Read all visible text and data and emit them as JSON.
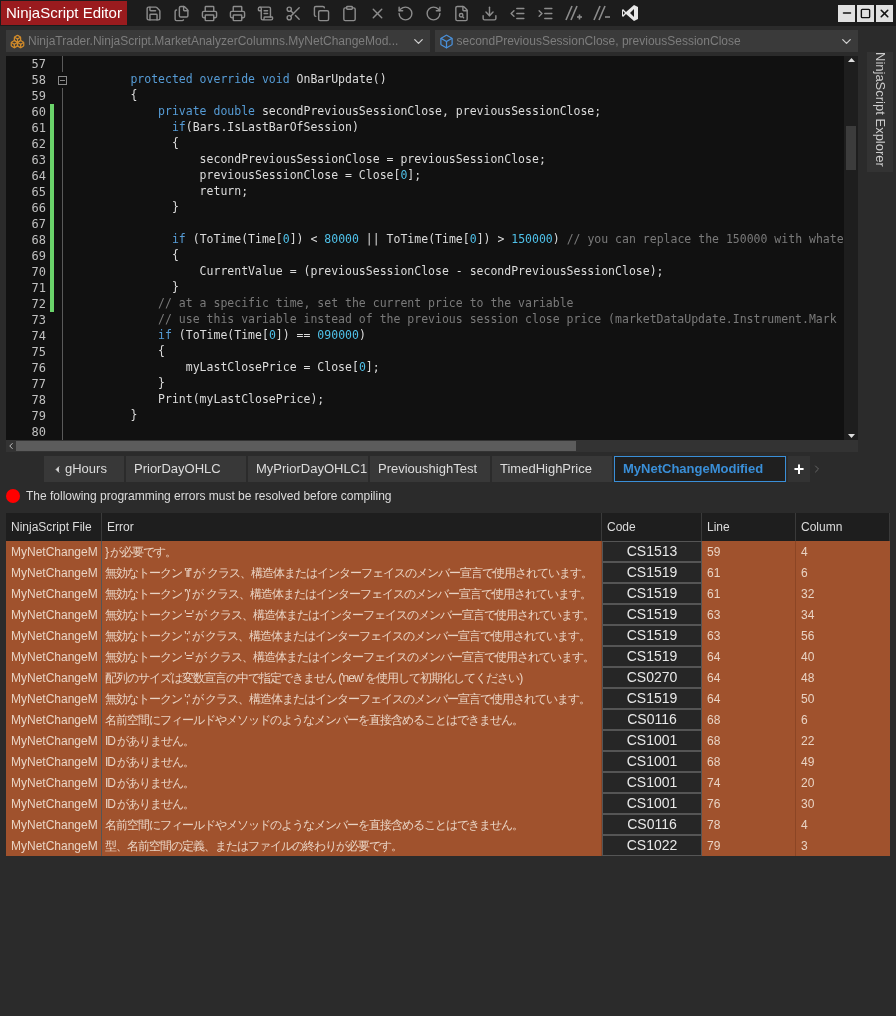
{
  "window": {
    "title": "NinjaScript Editor"
  },
  "dropdowns": [
    {
      "text": "NinjaTrader.NinjaScript.MarketAnalyzerColumns.MyNetChangeMod..."
    },
    {
      "text": "secondPreviousSessionClose, previousSessionClose"
    }
  ],
  "side_panel": {
    "label": "NinjaScript Explorer"
  },
  "editor": {
    "lines": [
      {
        "number": "57",
        "changed": false,
        "collapsible": false
      },
      {
        "number": "58",
        "changed": false,
        "collapsible": true,
        "tokens": [
          {
            "kind": "keyword",
            "text": "        protected override void"
          },
          {
            "kind": "plain",
            "text": " OnBarUpdate()"
          }
        ]
      },
      {
        "number": "59",
        "changed": false,
        "collapsible": false,
        "tokens": [
          {
            "kind": "plain",
            "text": "        {"
          }
        ]
      },
      {
        "number": "60",
        "changed": true,
        "collapsible": false,
        "tokens": [
          {
            "kind": "keyword",
            "text": "            private double"
          },
          {
            "kind": "plain",
            "text": " secondPreviousSessionClose, previousSessionClose;"
          }
        ]
      },
      {
        "number": "61",
        "changed": true,
        "collapsible": false,
        "tokens": [
          {
            "kind": "keyword",
            "text": "              if"
          },
          {
            "kind": "plain",
            "text": "(Bars.IsLastBarOfSession)"
          }
        ]
      },
      {
        "number": "62",
        "changed": true,
        "collapsible": false,
        "tokens": [
          {
            "kind": "plain",
            "text": "              {"
          }
        ]
      },
      {
        "number": "63",
        "changed": true,
        "collapsible": false,
        "tokens": [
          {
            "kind": "plain",
            "text": "                  secondPreviousSessionClose = previousSessionClose;"
          }
        ]
      },
      {
        "number": "64",
        "changed": true,
        "collapsible": false,
        "tokens": [
          {
            "kind": "plain",
            "text": "                  previousSessionClose = Close["
          },
          {
            "kind": "number",
            "text": "0"
          },
          {
            "kind": "plain",
            "text": "];"
          }
        ]
      },
      {
        "number": "65",
        "changed": true,
        "collapsible": false,
        "tokens": [
          {
            "kind": "plain",
            "text": "                  return;"
          }
        ]
      },
      {
        "number": "66",
        "changed": true,
        "collapsible": false,
        "tokens": [
          {
            "kind": "plain",
            "text": "              }"
          }
        ]
      },
      {
        "number": "67",
        "changed": true,
        "collapsible": false
      },
      {
        "number": "68",
        "changed": true,
        "collapsible": false,
        "tokens": [
          {
            "kind": "keyword",
            "text": "              if"
          },
          {
            "kind": "plain",
            "text": " (ToTime(Time["
          },
          {
            "kind": "number",
            "text": "0"
          },
          {
            "kind": "plain",
            "text": "]) < "
          },
          {
            "kind": "number",
            "text": "80000"
          },
          {
            "kind": "plain",
            "text": " || ToTime(Time["
          },
          {
            "kind": "number",
            "text": "0"
          },
          {
            "kind": "plain",
            "text": "]) > "
          },
          {
            "kind": "number",
            "text": "150000"
          },
          {
            "kind": "plain",
            "text": ")"
          },
          {
            "kind": "comment",
            "text": " // you can replace the 150000 with whate"
          }
        ]
      },
      {
        "number": "69",
        "changed": true,
        "collapsible": false,
        "tokens": [
          {
            "kind": "plain",
            "text": "              {"
          }
        ]
      },
      {
        "number": "70",
        "changed": true,
        "collapsible": false,
        "tokens": [
          {
            "kind": "plain",
            "text": "                  CurrentValue = (previousSessionClose - secondPreviousSessionClose);"
          }
        ]
      },
      {
        "number": "71",
        "changed": true,
        "collapsible": false,
        "tokens": [
          {
            "kind": "plain",
            "text": "              }"
          }
        ]
      },
      {
        "number": "72",
        "changed": true,
        "collapsible": false,
        "tokens": [
          {
            "kind": "comment",
            "text": "            // at a specific time, set the current price to the variable"
          }
        ]
      },
      {
        "number": "73",
        "changed": false,
        "collapsible": false,
        "tokens": [
          {
            "kind": "comment",
            "text": "            // use this variable instead of the previous session close price (marketDataUpdate.Instrument.Mark"
          }
        ]
      },
      {
        "number": "74",
        "changed": false,
        "collapsible": false,
        "tokens": [
          {
            "kind": "keyword",
            "text": "            if"
          },
          {
            "kind": "plain",
            "text": " (ToTime(Time["
          },
          {
            "kind": "number",
            "text": "0"
          },
          {
            "kind": "plain",
            "text": "]) == "
          },
          {
            "kind": "number",
            "text": "090000"
          },
          {
            "kind": "plain",
            "text": ")"
          }
        ]
      },
      {
        "number": "75",
        "changed": false,
        "collapsible": false,
        "tokens": [
          {
            "kind": "plain",
            "text": "            {"
          }
        ]
      },
      {
        "number": "76",
        "changed": false,
        "collapsible": false,
        "tokens": [
          {
            "kind": "plain",
            "text": "                myLastClosePrice = Close["
          },
          {
            "kind": "number",
            "text": "0"
          },
          {
            "kind": "plain",
            "text": "];"
          }
        ]
      },
      {
        "number": "77",
        "changed": false,
        "collapsible": false,
        "tokens": [
          {
            "kind": "plain",
            "text": "            }"
          }
        ]
      },
      {
        "number": "78",
        "changed": false,
        "collapsible": false,
        "tokens": [
          {
            "kind": "plain",
            "text": "            Print(myLastClosePrice);"
          }
        ]
      },
      {
        "number": "79",
        "changed": false,
        "collapsible": false,
        "tokens": [
          {
            "kind": "plain",
            "text": "        }"
          }
        ]
      },
      {
        "number": "80",
        "changed": false,
        "collapsible": false
      }
    ]
  },
  "file_tabs": [
    {
      "label": "gHours",
      "selected": false
    },
    {
      "label": "PriorDayOHLC",
      "selected": false
    },
    {
      "label": "MyPriorDayOHLC1",
      "selected": false
    },
    {
      "label": "PrevioushighTest",
      "selected": false
    },
    {
      "label": "TimedHighPrice",
      "selected": false
    },
    {
      "label": "MyNetChangeModified",
      "selected": true
    }
  ],
  "add_tab": "+",
  "error_message": "The following programming errors must be resolved before compiling",
  "errors_table": {
    "columns": [
      "NinjaScript File",
      "Error",
      "Code",
      "Line",
      "Column"
    ],
    "rows": [
      [
        "MyNetChangeM",
        "} が必要です。",
        "CS1513",
        "59",
        "4"
      ],
      [
        "MyNetChangeM",
        "無効なトークン 'if' が クラス、構造体またはインターフェイスのメンバー宣言で使用されています。",
        "CS1519",
        "61",
        "6"
      ],
      [
        "MyNetChangeM",
        "無効なトークン ')' が クラス、構造体またはインターフェイスのメンバー宣言で使用されています。",
        "CS1519",
        "61",
        "32"
      ],
      [
        "MyNetChangeM",
        "無効なトークン '=' が クラス、構造体またはインターフェイスのメンバー宣言で使用されています。",
        "CS1519",
        "63",
        "34"
      ],
      [
        "MyNetChangeM",
        "無効なトークン ';' が クラス、構造体またはインターフェイスのメンバー宣言で使用されています。",
        "CS1519",
        "63",
        "56"
      ],
      [
        "MyNetChangeM",
        "無効なトークン '=' が クラス、構造体またはインターフェイスのメンバー宣言で使用されています。",
        "CS1519",
        "64",
        "40"
      ],
      [
        "MyNetChangeM",
        "配列のサイズは変数宣言の中で指定できません ('new' を使用して初期化してください)",
        "CS0270",
        "64",
        "48"
      ],
      [
        "MyNetChangeM",
        "無効なトークン ';' が クラス、構造体またはインターフェイスのメンバー宣言で使用されています。",
        "CS1519",
        "64",
        "50"
      ],
      [
        "MyNetChangeM",
        "名前空間にフィールドやメソッドのようなメンバーを直接含めることはできません。",
        "CS0116",
        "68",
        "6"
      ],
      [
        "MyNetChangeM",
        "ID がありません。",
        "CS1001",
        "68",
        "22"
      ],
      [
        "MyNetChangeM",
        "ID がありません。",
        "CS1001",
        "68",
        "49"
      ],
      [
        "MyNetChangeM",
        "ID がありません。",
        "CS1001",
        "74",
        "20"
      ],
      [
        "MyNetChangeM",
        "ID がありません。",
        "CS1001",
        "76",
        "30"
      ],
      [
        "MyNetChangeM",
        "名前空間にフィールドやメソッドのようなメンバーを直接含めることはできません。",
        "CS0116",
        "78",
        "4"
      ],
      [
        "MyNetChangeM",
        "型、名前空間の定義、またはファイルの終わりが必要です。",
        "CS1022",
        "79",
        "3"
      ]
    ]
  }
}
